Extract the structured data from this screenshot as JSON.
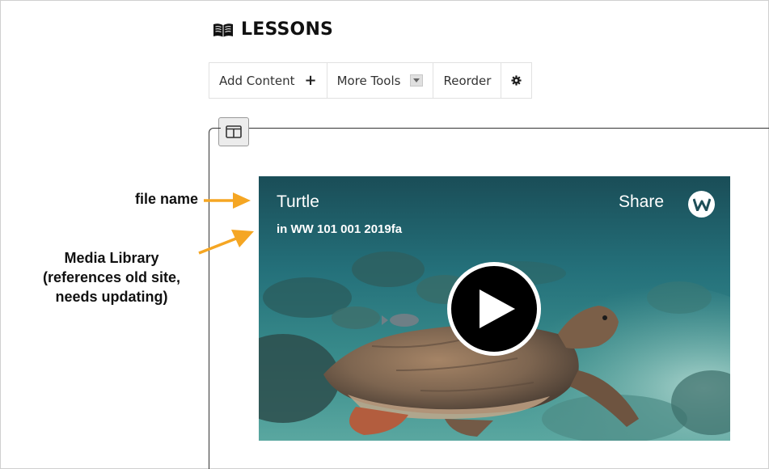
{
  "header": {
    "title": "LESSONS",
    "icon": "open-book-icon"
  },
  "toolbar": {
    "add_content": "Add Content",
    "add_content_icon": "+",
    "more_tools": "More Tools",
    "reorder": "Reorder",
    "settings_icon": "gear-icon"
  },
  "video": {
    "title": "Turtle",
    "subtitle": "in WW 101 001 2019fa",
    "share_label": "Share",
    "logo_icon": "w-logo-icon"
  },
  "annotations": {
    "file_name": "file name",
    "media_library_line1": "Media Library",
    "media_library_line2": "(references old site,",
    "media_library_line3": "needs updating)"
  },
  "colors": {
    "annotation_arrow": "#f5a623",
    "video_water": "#1f6a70"
  }
}
